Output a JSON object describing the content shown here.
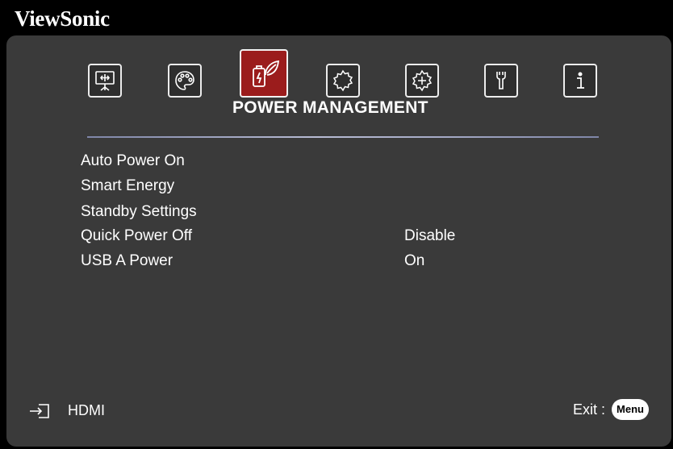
{
  "brand": "ViewSonic",
  "tabs": [
    {
      "name": "display-icon"
    },
    {
      "name": "image-settings-icon"
    },
    {
      "name": "power-management-icon"
    },
    {
      "name": "basic-settings-icon"
    },
    {
      "name": "advanced-settings-icon"
    },
    {
      "name": "system-icon"
    },
    {
      "name": "information-icon"
    }
  ],
  "section_title": "POWER MANAGEMENT",
  "menu_items": [
    {
      "label": "Auto Power On",
      "value": ""
    },
    {
      "label": "Smart Energy",
      "value": ""
    },
    {
      "label": "Standby Settings",
      "value": ""
    },
    {
      "label": "Quick Power Off",
      "value": "Disable"
    },
    {
      "label": "USB A Power",
      "value": "On"
    }
  ],
  "footer": {
    "source": "HDMI",
    "exit_label": "Exit :",
    "menu_key": "Menu"
  },
  "colors": {
    "active_tab": "#9b1c1c",
    "panel_bg": "#3a3a3a",
    "screen_bg": "#000000"
  }
}
